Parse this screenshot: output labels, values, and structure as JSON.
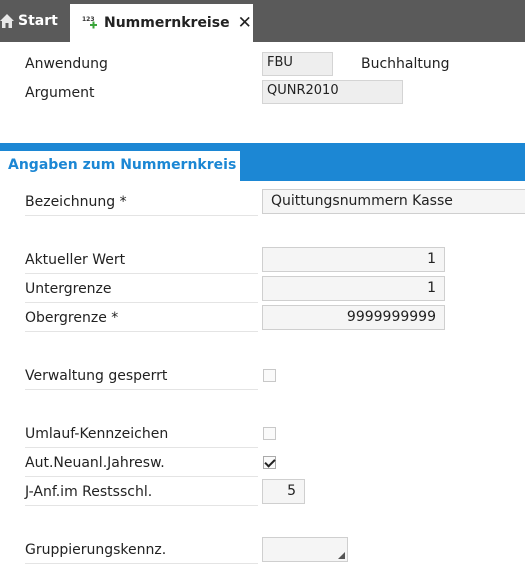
{
  "tabs": {
    "start_label": "Start",
    "active_label": "Nummernkreise"
  },
  "header": {
    "anwendung_label": "Anwendung",
    "anwendung_value": "FBU",
    "anwendung_description": "Buchhaltung",
    "argument_label": "Argument",
    "argument_value": "QUNR2010"
  },
  "section": {
    "title": "Angaben zum Nummernkreis"
  },
  "form": {
    "bezeichnung_label": "Bezeichnung *",
    "bezeichnung_value": "Quittungsnummern Kasse",
    "aktueller_wert_label": "Aktueller Wert",
    "aktueller_wert_value": "1",
    "untergrenze_label": "Untergrenze",
    "untergrenze_value": "1",
    "obergrenze_label": "Obergrenze *",
    "obergrenze_value": "9999999999",
    "verwaltung_gesperrt_label": "Verwaltung gesperrt",
    "verwaltung_gesperrt_checked": false,
    "umlauf_kennzeichen_label": "Umlauf-Kennzeichen",
    "umlauf_kennzeichen_checked": false,
    "aut_neuanl_label": "Aut.Neuanl.Jahresw.",
    "aut_neuanl_checked": true,
    "j_anf_label": "J-Anf.im Restsschl.",
    "j_anf_value": "5",
    "gruppierung_label": "Gruppierungskennz.",
    "gruppierung_value": ""
  },
  "colors": {
    "tabbar_bg": "#5a5a5a",
    "accent": "#1c87d4"
  }
}
